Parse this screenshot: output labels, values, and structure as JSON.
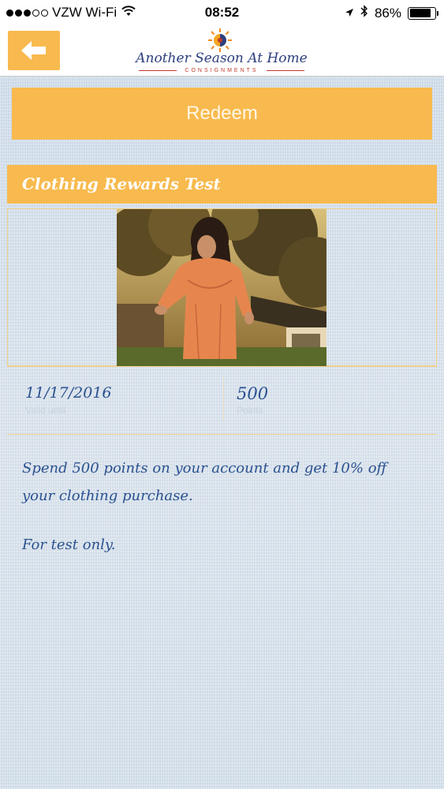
{
  "status_bar": {
    "carrier": "VZW Wi-Fi",
    "time": "08:52",
    "battery": "86%",
    "battery_level": 0.86
  },
  "header": {
    "logo_name": "Another Season At Home",
    "logo_sub": "CONSIGNMENTS"
  },
  "redeem": {
    "label": "Redeem"
  },
  "reward": {
    "title": "Clothing Rewards Test",
    "date": "11/17/2016",
    "date_label": "Valid until",
    "points": "500",
    "points_label": "Points",
    "description": "Spend 500 points on your account and get 10% off your clothing purchase.",
    "note": "For test only."
  },
  "colors": {
    "accent": "#f8ba4e",
    "text": "#2a5190",
    "logo_blue": "#2d3f7e",
    "logo_red": "#c0392b"
  }
}
